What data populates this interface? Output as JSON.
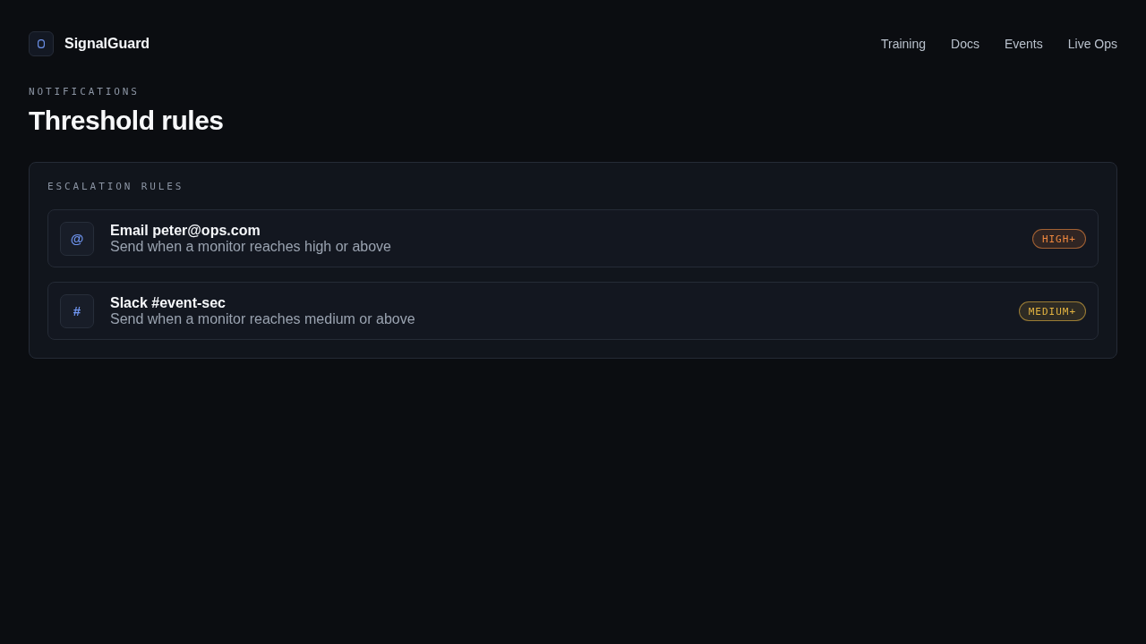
{
  "brand": {
    "name": "SignalGuard"
  },
  "nav": [
    {
      "label": "Training"
    },
    {
      "label": "Docs"
    },
    {
      "label": "Events"
    },
    {
      "label": "Live Ops"
    }
  ],
  "page": {
    "eyebrow": "NOTIFICATIONS",
    "title": "Threshold rules"
  },
  "panel": {
    "title": "ESCALATION RULES",
    "rules": [
      {
        "icon": "@",
        "title": "Email peter@ops.com",
        "description": "Send when a monitor reaches high or above",
        "badge": "HIGH+",
        "color": "#f0883e"
      },
      {
        "icon": "#",
        "title": "Slack #event-sec",
        "description": "Send when a monitor reaches medium or above",
        "badge": "MEDIUM+",
        "color": "#e3b341"
      }
    ]
  }
}
